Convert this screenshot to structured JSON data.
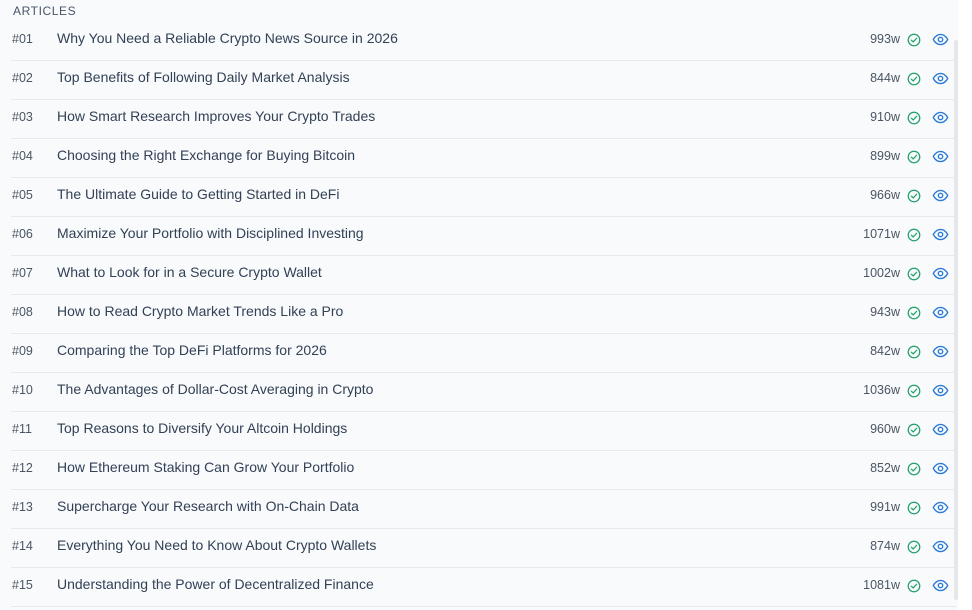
{
  "section": {
    "title": "ARTICLES"
  },
  "articles": [
    {
      "num": "#01",
      "title": "Why You Need a Reliable Crypto News Source in 2026",
      "words": "993w"
    },
    {
      "num": "#02",
      "title": "Top Benefits of Following Daily Market Analysis",
      "words": "844w"
    },
    {
      "num": "#03",
      "title": "How Smart Research Improves Your Crypto Trades",
      "words": "910w"
    },
    {
      "num": "#04",
      "title": "Choosing the Right Exchange for Buying Bitcoin",
      "words": "899w"
    },
    {
      "num": "#05",
      "title": "The Ultimate Guide to Getting Started in DeFi",
      "words": "966w"
    },
    {
      "num": "#06",
      "title": "Maximize Your Portfolio with Disciplined Investing",
      "words": "1071w"
    },
    {
      "num": "#07",
      "title": "What to Look for in a Secure Crypto Wallet",
      "words": "1002w"
    },
    {
      "num": "#08",
      "title": "How to Read Crypto Market Trends Like a Pro",
      "words": "943w"
    },
    {
      "num": "#09",
      "title": "Comparing the Top DeFi Platforms for 2026",
      "words": "842w"
    },
    {
      "num": "#10",
      "title": "The Advantages of Dollar-Cost Averaging in Crypto",
      "words": "1036w"
    },
    {
      "num": "#11",
      "title": "Top Reasons to Diversify Your Altcoin Holdings",
      "words": "960w"
    },
    {
      "num": "#12",
      "title": "How Ethereum Staking Can Grow Your Portfolio",
      "words": "852w"
    },
    {
      "num": "#13",
      "title": "Supercharge Your Research with On-Chain Data",
      "words": "991w"
    },
    {
      "num": "#14",
      "title": "Everything You Need to Know About Crypto Wallets",
      "words": "874w"
    },
    {
      "num": "#15",
      "title": "Understanding the Power of Decentralized Finance",
      "words": "1081w"
    }
  ],
  "icons": {
    "status": "check-circle-icon",
    "view": "eye-icon"
  },
  "colors": {
    "check": "#22a06b",
    "eye": "#2b7bd6",
    "text": "#334155",
    "muted": "#4b5563"
  }
}
